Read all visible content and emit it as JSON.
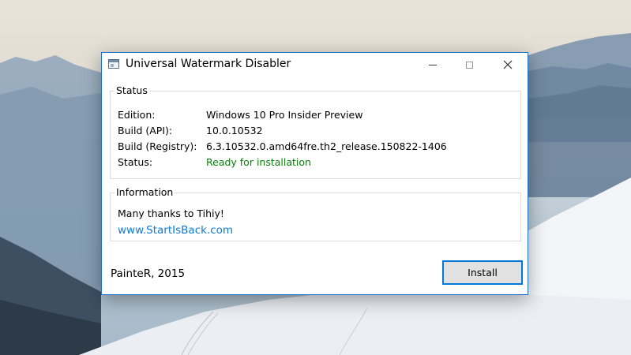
{
  "window": {
    "title": "Universal Watermark Disabler"
  },
  "status_group": {
    "legend": "Status",
    "rows": [
      {
        "label": "Edition:",
        "value": "Windows 10 Pro Insider Preview"
      },
      {
        "label": "Build (API):",
        "value": "10.0.10532"
      },
      {
        "label": "Build (Registry):",
        "value": "6.3.10532.0.amd64fre.th2_release.150822-1406"
      },
      {
        "label": "Status:",
        "value": "Ready for installation"
      }
    ]
  },
  "info_group": {
    "legend": "Information",
    "thanks": "Many thanks to Tihiy!",
    "link": "www.StartIsBack.com"
  },
  "footer": {
    "author": "PainteR, 2015",
    "install_label": "Install"
  },
  "icons": {
    "app": "window-app-icon",
    "minimize": "minimize-icon",
    "maximize": "maximize-icon",
    "close": "close-icon"
  },
  "colors": {
    "status_ready": "#0a7f0a",
    "link": "#0f7ad3",
    "accent": "#0078d7"
  }
}
